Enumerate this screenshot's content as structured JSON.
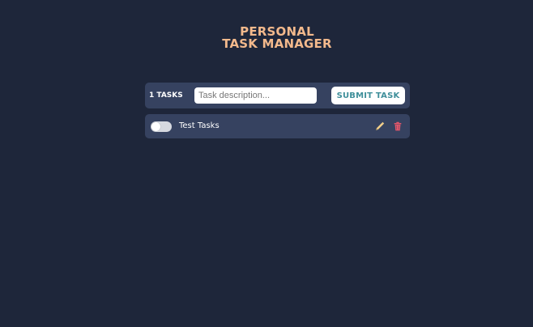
{
  "header": {
    "title_line1": "PERSONAL",
    "title_line2": "TASK MANAGER"
  },
  "toolbar": {
    "task_count": "1 TASKS",
    "input_placeholder": "Task description...",
    "input_value": "",
    "submit_label": "SUBMIT TASK"
  },
  "tasks": [
    {
      "text": "Test Tasks",
      "completed": false,
      "edit_icon": "pencil-icon",
      "delete_icon": "trash-icon"
    }
  ],
  "colors": {
    "background": "#1e263a",
    "panel": "#364260",
    "title": "#f3b98c",
    "submit_text": "#3f8f9a",
    "edit_icon": "#f3d08a",
    "delete_icon": "#e2566a"
  }
}
